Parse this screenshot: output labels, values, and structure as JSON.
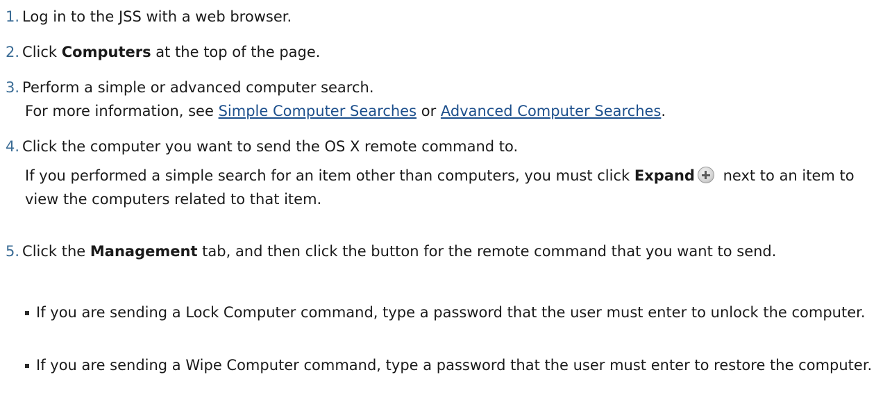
{
  "steps": [
    {
      "num": "1.",
      "text": "Log in to the JSS with a web browser."
    },
    {
      "num": "2.",
      "pre": "Click ",
      "bold": "Computers",
      "post": " at the top of the page."
    },
    {
      "num": "3.",
      "line1": "Perform a simple or advanced computer search.",
      "line2_pre": "For more information, see ",
      "link1": "Simple Computer Searches",
      "line2_mid": " or ",
      "link2": "Advanced Computer Searches",
      "line2_post": "."
    },
    {
      "num": "4.",
      "line1": "Click the computer you want to send the OS X remote command to.",
      "para_pre": "If you performed a simple search for an item other than computers, you must click ",
      "bold": "Expand",
      "para_post": " next to an item to view the computers related to that item."
    },
    {
      "num": "5.",
      "pre": "Click the ",
      "bold": "Management",
      "post": " tab, and then click the button for the remote command that you want to send.",
      "bullets": [
        "If you are sending a Lock Computer command, type a password that the user must enter to unlock the computer.",
        "If you are sending a Wipe Computer command, type a password that the user must enter to restore the computer."
      ]
    }
  ],
  "icons": {
    "expand": "plus-circle-icon"
  }
}
